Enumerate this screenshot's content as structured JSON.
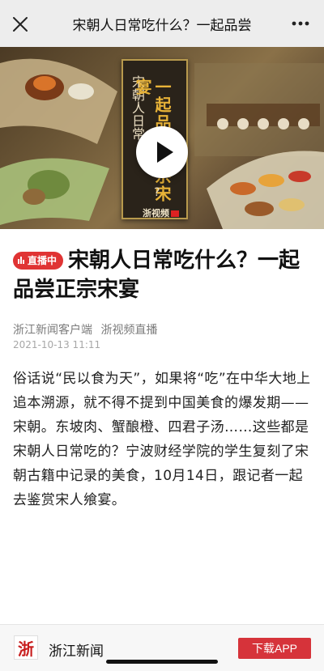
{
  "navbar": {
    "title": "宋朝人日常吃什么？一起品尝",
    "close_icon": "close-icon",
    "more_icon": "more-icon"
  },
  "video": {
    "scroll_gold_text": "一起品尝正宗宋宴",
    "scroll_light_text": "宋朝人日常",
    "scroll_question": "?",
    "logo_text": "浙视频",
    "play_icon": "play-icon"
  },
  "article": {
    "live_badge": "直播中",
    "title": "宋朝人日常吃什么？一起品尝正宗宋宴",
    "source_name": "浙江新闻客户端",
    "source_channel": "浙视频直播",
    "date": "2021-10-13 11:11",
    "body": "俗话说“民以食为天”，如果将“吃”在中华大地上追本溯源，就不得不提到中国美食的爆发期——宋朝。东坡肉、蟹酿橙、四君子汤……这些都是宋朝人日常吃的？宁波财经学院的学生复刻了宋朝古籍中记录的美食，10月14日，跟记者一起去鉴赏宋人飨宴。"
  },
  "bottom_bar": {
    "app_logo": "浙",
    "app_name": "浙江新闻",
    "download_label": "下载APP"
  },
  "colors": {
    "accent_red": "#d6333a",
    "live_badge": "#e03434",
    "navbar_bg": "#ededed"
  }
}
